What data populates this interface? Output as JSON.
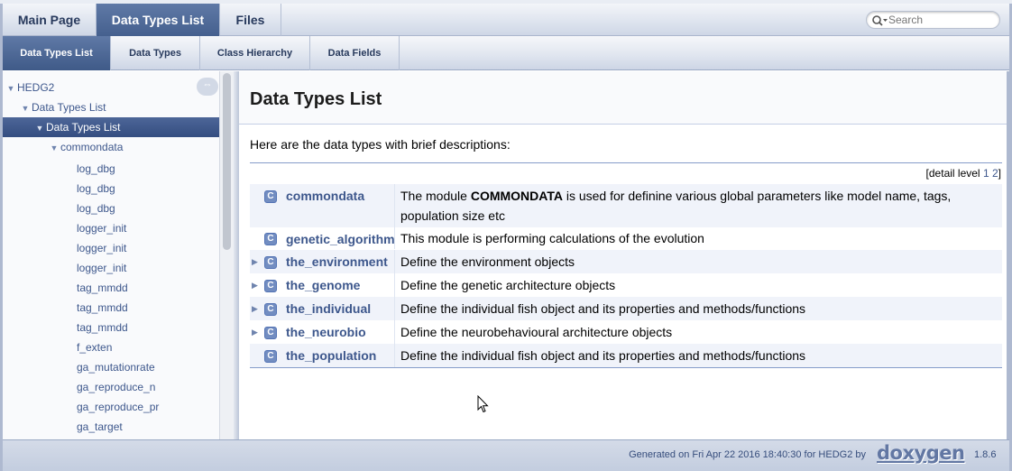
{
  "top_tabs": [
    {
      "label": "Main Page",
      "active": false
    },
    {
      "label": "Data Types List",
      "active": true
    },
    {
      "label": "Files",
      "active": false
    }
  ],
  "search": {
    "placeholder": "Search"
  },
  "sub_tabs": [
    {
      "label": "Data Types List",
      "active": true
    },
    {
      "label": "Data Types",
      "active": false
    },
    {
      "label": "Class Hierarchy",
      "active": false
    },
    {
      "label": "Data Fields",
      "active": false
    }
  ],
  "sidebar": {
    "sync_icon": "sync-arrows-icon",
    "items": [
      {
        "label": "HEDG2",
        "arrow": "▼"
      },
      {
        "label": "Data Types List",
        "arrow": "▼"
      },
      {
        "label": "Data Types List",
        "arrow": "▼"
      },
      {
        "label": "commondata",
        "arrow": "▼"
      },
      {
        "label": "log_dbg",
        "arrow": ""
      },
      {
        "label": "log_dbg",
        "arrow": ""
      },
      {
        "label": "log_dbg",
        "arrow": ""
      },
      {
        "label": "logger_init",
        "arrow": ""
      },
      {
        "label": "logger_init",
        "arrow": ""
      },
      {
        "label": "logger_init",
        "arrow": ""
      },
      {
        "label": "tag_mmdd",
        "arrow": ""
      },
      {
        "label": "tag_mmdd",
        "arrow": ""
      },
      {
        "label": "tag_mmdd",
        "arrow": ""
      },
      {
        "label": "f_exten",
        "arrow": ""
      },
      {
        "label": "ga_mutationrate",
        "arrow": ""
      },
      {
        "label": "ga_reproduce_n",
        "arrow": ""
      },
      {
        "label": "ga_reproduce_pr",
        "arrow": ""
      },
      {
        "label": "ga_target",
        "arrow": ""
      }
    ]
  },
  "main": {
    "title": "Data Types List",
    "intro": "Here are the data types with brief descriptions:",
    "detail_level_label": "[detail level",
    "detail_levels": [
      "1",
      "2"
    ],
    "detail_level_close": "]",
    "badge_letter": "C",
    "rows": [
      {
        "name": "commondata",
        "desc_before": "The module ",
        "desc_bold": "COMMONDATA",
        "desc_after": " is used for definine various global parameters like model name, tags, population size etc",
        "expandable": false
      },
      {
        "name": "genetic_algorithm",
        "desc_before": "This module is performing calculations of the evolution",
        "desc_bold": "",
        "desc_after": "",
        "expandable": false
      },
      {
        "name": "the_environment",
        "desc_before": "Define the environment objects",
        "desc_bold": "",
        "desc_after": "",
        "expandable": true
      },
      {
        "name": "the_genome",
        "desc_before": "Define the genetic architecture objects",
        "desc_bold": "",
        "desc_after": "",
        "expandable": true
      },
      {
        "name": "the_individual",
        "desc_before": "Define the individual fish object and its properties and methods/functions",
        "desc_bold": "",
        "desc_after": "",
        "expandable": true
      },
      {
        "name": "the_neurobio",
        "desc_before": "Define the neurobehavioural architecture objects",
        "desc_bold": "",
        "desc_after": "",
        "expandable": true
      },
      {
        "name": "the_population",
        "desc_before": "Define the individual fish object and its properties and methods/functions",
        "desc_bold": "",
        "desc_after": "",
        "expandable": false
      }
    ]
  },
  "footer": {
    "text": "Generated on Fri Apr 22 2016 18:40:30 for HEDG2 by",
    "logo": "doxygen",
    "version": "1.8.6"
  },
  "colors": {
    "accent": "#3d578c",
    "header_tab_active": "#45608e"
  }
}
